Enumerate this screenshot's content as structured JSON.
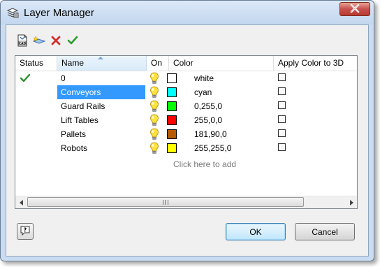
{
  "window": {
    "title": "Layer Manager",
    "close_glyph": "✕"
  },
  "toolbar": {
    "buttons": [
      {
        "icon": "import-cad-icon",
        "label": "CAD"
      },
      {
        "icon": "new-layer-icon"
      },
      {
        "icon": "delete-icon",
        "glyph": "✕"
      },
      {
        "icon": "set-current-icon",
        "glyph": "✔"
      }
    ]
  },
  "grid": {
    "columns": {
      "status": "Status",
      "name": "Name",
      "on": "On",
      "color": "Color",
      "apply3d": "Apply Color to 3D"
    },
    "rows": [
      {
        "status": "✔",
        "name": "0",
        "on": true,
        "color_hex": "#ffffff",
        "color_text": "white",
        "apply3d": false,
        "selected": false
      },
      {
        "status": "",
        "name": "Conveyors",
        "on": true,
        "color_hex": "#00ffff",
        "color_text": "cyan",
        "apply3d": false,
        "selected": true
      },
      {
        "status": "",
        "name": "Guard Rails",
        "on": true,
        "color_hex": "#00ff00",
        "color_text": "0,255,0",
        "apply3d": false,
        "selected": false
      },
      {
        "status": "",
        "name": "Lift Tables",
        "on": true,
        "color_hex": "#ff0000",
        "color_text": "255,0,0",
        "apply3d": false,
        "selected": false
      },
      {
        "status": "",
        "name": "Pallets",
        "on": true,
        "color_hex": "#b55a00",
        "color_text": "181,90,0",
        "apply3d": false,
        "selected": false
      },
      {
        "status": "",
        "name": "Robots",
        "on": true,
        "color_hex": "#ffff00",
        "color_text": "255,255,0",
        "apply3d": false,
        "selected": false
      }
    ],
    "add_hint": "Click here to add"
  },
  "scrollbar": {
    "left_glyph": "◂",
    "right_glyph": "▸"
  },
  "buttons": {
    "help_glyph": "?",
    "ok": "OK",
    "cancel": "Cancel"
  },
  "colors": {
    "selection": "#3399ff",
    "status_check": "#2e8b2e",
    "delete_x": "#d03030",
    "bulb": "#ffe23c"
  }
}
